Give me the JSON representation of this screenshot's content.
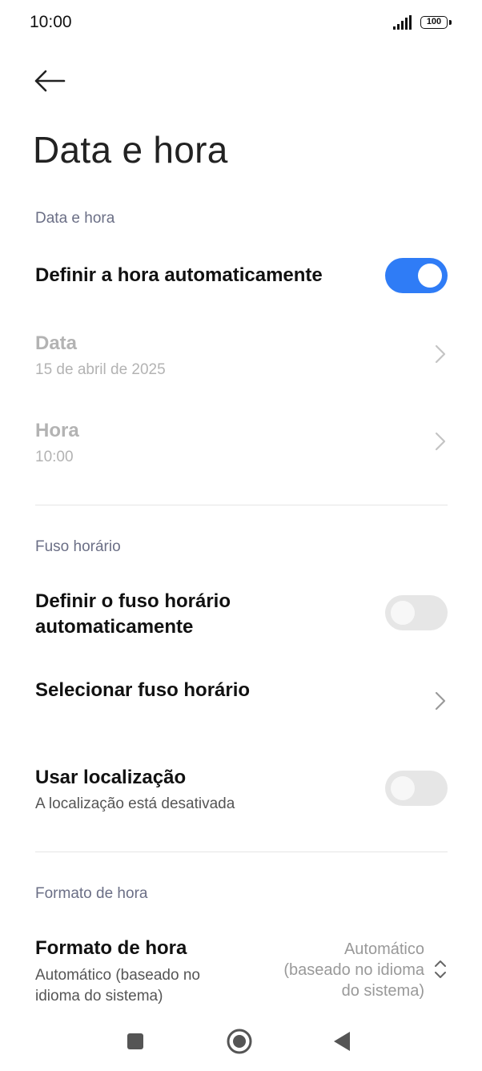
{
  "status_bar": {
    "time": "10:00",
    "battery": "100",
    "icons": [
      "signal-icon",
      "battery-icon"
    ]
  },
  "header": {
    "back_icon": "arrow-left-icon",
    "title": "Data e hora"
  },
  "sections": {
    "date_time": {
      "header": "Data e hora",
      "auto_time": {
        "title": "Definir a hora automaticamente",
        "enabled": true
      },
      "date": {
        "title": "Data",
        "value": "15 de abril de 2025"
      },
      "time": {
        "title": "Hora",
        "value": "10:00"
      }
    },
    "timezone": {
      "header": "Fuso horário",
      "auto_zone": {
        "title_line1": "Definir o fuso horário",
        "title_line2": "automaticamente",
        "enabled": false
      },
      "select_zone": {
        "title": "Selecionar fuso horário"
      },
      "use_location": {
        "title": "Usar localização",
        "subtitle": "A localização está desativada",
        "enabled": false
      }
    },
    "time_format": {
      "header": "Formato de hora",
      "format": {
        "title": "Formato de hora",
        "subtitle_line1": "Automático (baseado no",
        "subtitle_line2": "idioma do sistema)",
        "value_line1": "Automático",
        "value_line2": "(baseado no idioma",
        "value_line3": "do sistema)"
      }
    }
  },
  "colors": {
    "accent": "#2f7cf6",
    "section_header": "#6b6f86",
    "disabled_text": "#b3b3b3"
  },
  "nav_bar": {
    "icons": [
      "recents-square-icon",
      "home-circle-icon",
      "back-triangle-icon"
    ]
  }
}
